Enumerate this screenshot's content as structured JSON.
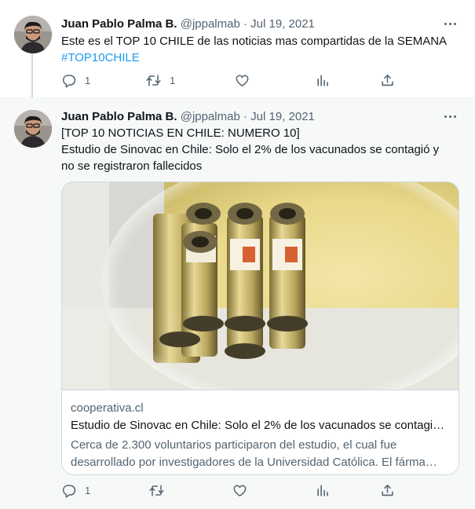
{
  "tweets": [
    {
      "author_name": "Juan Pablo Palma B.",
      "handle": "@jppalmab",
      "separator": "·",
      "date": "Jul 19, 2021",
      "text_line1": "Este es el TOP 10 CHILE de las noticias mas compartidas de la SEMANA",
      "hashtag": "#TOP10CHILE",
      "reply_count": "1",
      "retweet_count": "1",
      "like_count": "",
      "icons": [
        "reply-icon",
        "retweet-icon",
        "like-icon",
        "analytics-icon",
        "share-icon",
        "more-icon"
      ]
    },
    {
      "author_name": "Juan Pablo Palma B.",
      "handle": "@jppalmab",
      "separator": "·",
      "date": "Jul 19, 2021",
      "text_line1": "[TOP 10 NOTICIAS EN CHILE: NUMERO 10]",
      "text_line2": "Estudio de Sinovac en Chile: Solo el 2% de los vacunados se contagió y",
      "text_line3": "no se registraron fallecidos",
      "card": {
        "domain": "cooperativa.cl",
        "title": "Estudio de Sinovac en Chile: Solo el 2% de los vacunados se contagi…",
        "description_line1": "Cerca de 2.300 voluntarios participaron del estudio, el cual fue",
        "description_line2": "desarrollado por investigadores de la Universidad Católica. El fárma…"
      },
      "reply_count": "1",
      "retweet_count": "",
      "like_count": "",
      "icons": [
        "reply-icon",
        "retweet-icon",
        "like-icon",
        "analytics-icon",
        "share-icon",
        "more-icon"
      ]
    }
  ],
  "colors": {
    "link": "#1d9bf0",
    "secondary_text": "#536471",
    "primary_text": "#0f1419",
    "highlight_bg": "#f7f9f9"
  }
}
